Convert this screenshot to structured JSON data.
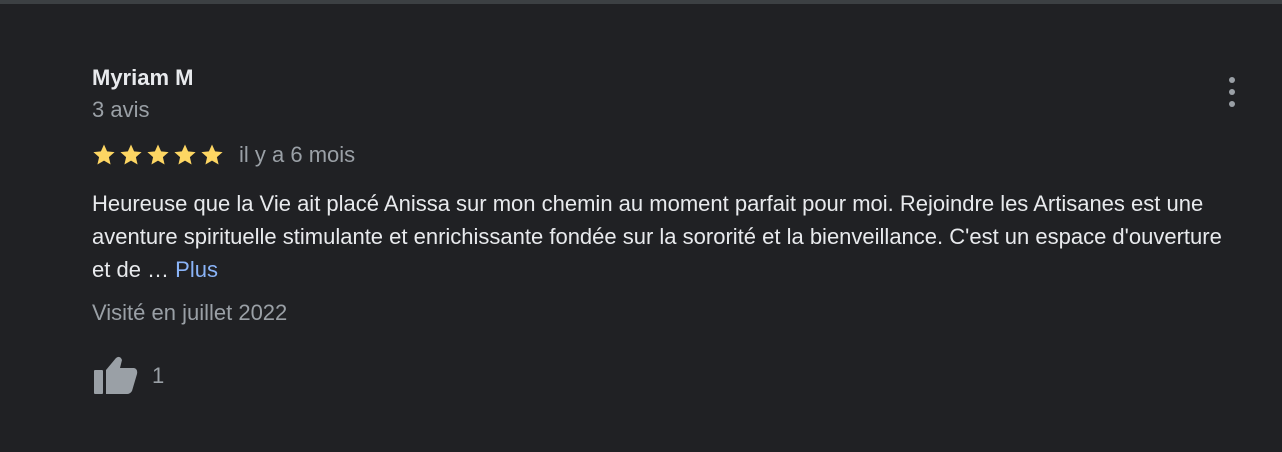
{
  "review": {
    "reviewer_name": "Myriam M",
    "review_count": "3 avis",
    "rating": 5,
    "rating_max": 5,
    "date": "il y a 6 mois",
    "text": "Heureuse que la Vie ait placé Anissa sur mon chemin au moment parfait pour moi. Rejoindre les Artisanes est une aventure spirituelle stimulante et enrichissante fondée sur la sororité et la bienveillance. C'est un espace d'ouverture et de …",
    "more_label": "Plus",
    "visited": "Visité en juillet 2022",
    "like_count": "1"
  },
  "icons": {
    "star": "star-icon",
    "more": "more-vert-icon",
    "like": "thumb-up-icon"
  },
  "colors": {
    "background": "#202124",
    "star": "#fdd663",
    "link": "#8ab4f8",
    "primary_text": "#e8eaed",
    "secondary_text": "#9aa0a6"
  }
}
